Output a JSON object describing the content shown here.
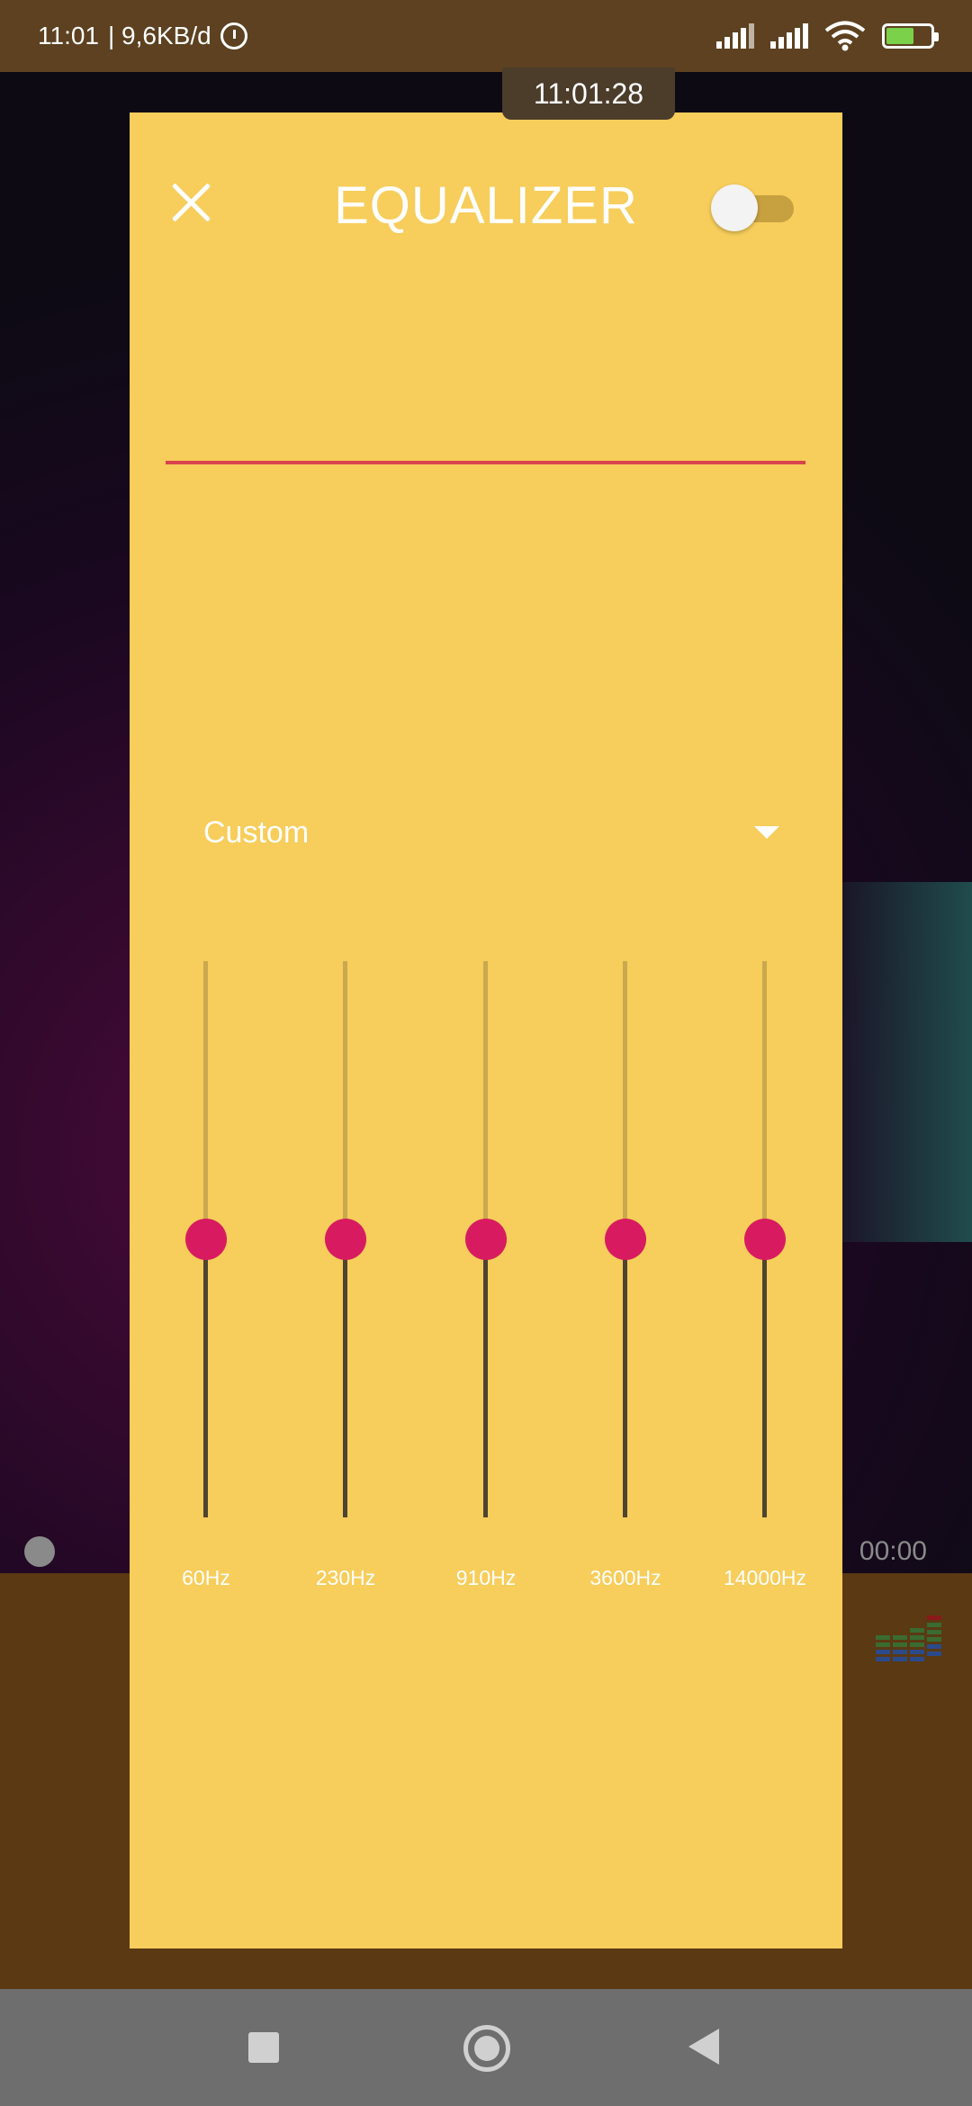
{
  "status_bar": {
    "time": "11:01",
    "speed": "| 9,6KB/d",
    "icons": [
      "alarm-icon",
      "signal-icon",
      "signal-icon",
      "wifi-icon",
      "battery-charging-icon"
    ]
  },
  "overlay_clock": "11:01:28",
  "player": {
    "elapsed": "00:00"
  },
  "equalizer": {
    "title": "EQUALIZER",
    "enabled": false,
    "preset": "Custom",
    "bands": [
      {
        "label": "60Hz",
        "level": 0.5
      },
      {
        "label": "230Hz",
        "level": 0.5
      },
      {
        "label": "910Hz",
        "level": 0.5
      },
      {
        "label": "3600Hz",
        "level": 0.5
      },
      {
        "label": "14000Hz",
        "level": 0.5
      }
    ]
  },
  "colors": {
    "dialog_bg": "#f7cd5b",
    "knob": "#d81b60",
    "divider": "#d9434d"
  }
}
